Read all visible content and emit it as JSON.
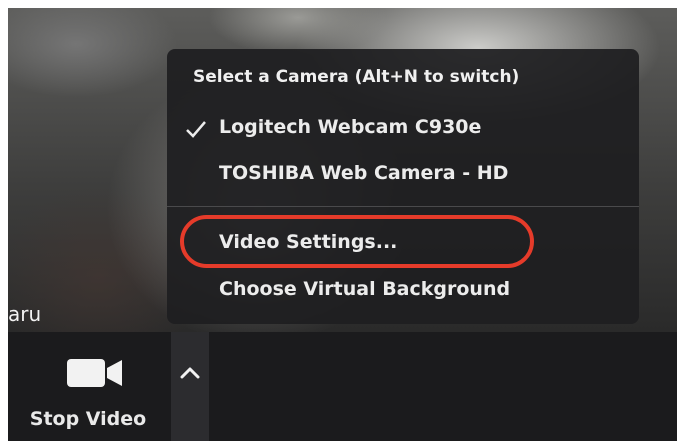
{
  "participant": {
    "name": "aru"
  },
  "camera_menu": {
    "header": "Select a Camera (Alt+N to switch)",
    "cameras": [
      {
        "label": "Logitech Webcam C930e",
        "selected": true
      },
      {
        "label": "TOSHIBA Web Camera - HD",
        "selected": false
      }
    ],
    "video_settings_label": "Video Settings...",
    "virtual_background_label": "Choose Virtual Background"
  },
  "toolbar": {
    "stop_video_label": "Stop Video"
  },
  "colors": {
    "toolbar_bg": "#1b1b1d",
    "menu_bg": "#1e1e20",
    "highlight": "#e53b2a",
    "text": "#ececec"
  },
  "icons": {
    "camera": "video-camera-icon",
    "check": "check-icon",
    "caret": "chevron-up-icon"
  }
}
